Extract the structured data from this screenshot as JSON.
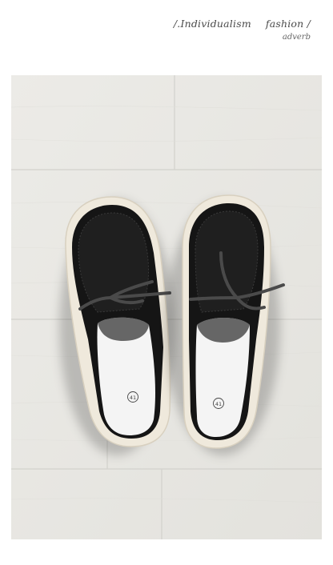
{
  "header": {
    "tagline_left": "/.Individualism",
    "tagline_right": "fashion /",
    "subline": "adverb"
  },
  "photo": {
    "subject": "shoe-pair-icon",
    "size_label_left": "41",
    "size_label_right": "41",
    "colors": {
      "wood": "#e9e8e4",
      "upper": "#141414",
      "sole": "#efe9dc",
      "insole": "#f4f4f4",
      "lace": "#4a4a4a"
    }
  }
}
